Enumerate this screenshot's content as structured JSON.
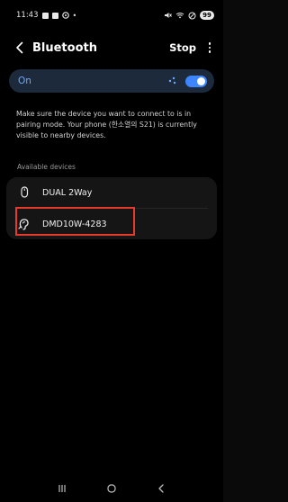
{
  "status_bar": {
    "time": "11:43",
    "battery": "99"
  },
  "header": {
    "title": "Bluetooth",
    "stop_label": "Stop"
  },
  "toggle": {
    "label": "On",
    "state": "on"
  },
  "description": "Make sure the device you want to connect to is in pairing mode. Your phone (한소열의 S21) is currently visible to nearby devices.",
  "section_label": "Available devices",
  "devices": [
    {
      "name": "DUAL 2Way",
      "icon": "mouse-icon"
    },
    {
      "name": "DMD10W-4283",
      "icon": "ear-hearing-icon"
    }
  ],
  "colors": {
    "accent": "#3e86ff",
    "toggle_text": "#6fa7ff",
    "highlight": "#e53b2c"
  }
}
